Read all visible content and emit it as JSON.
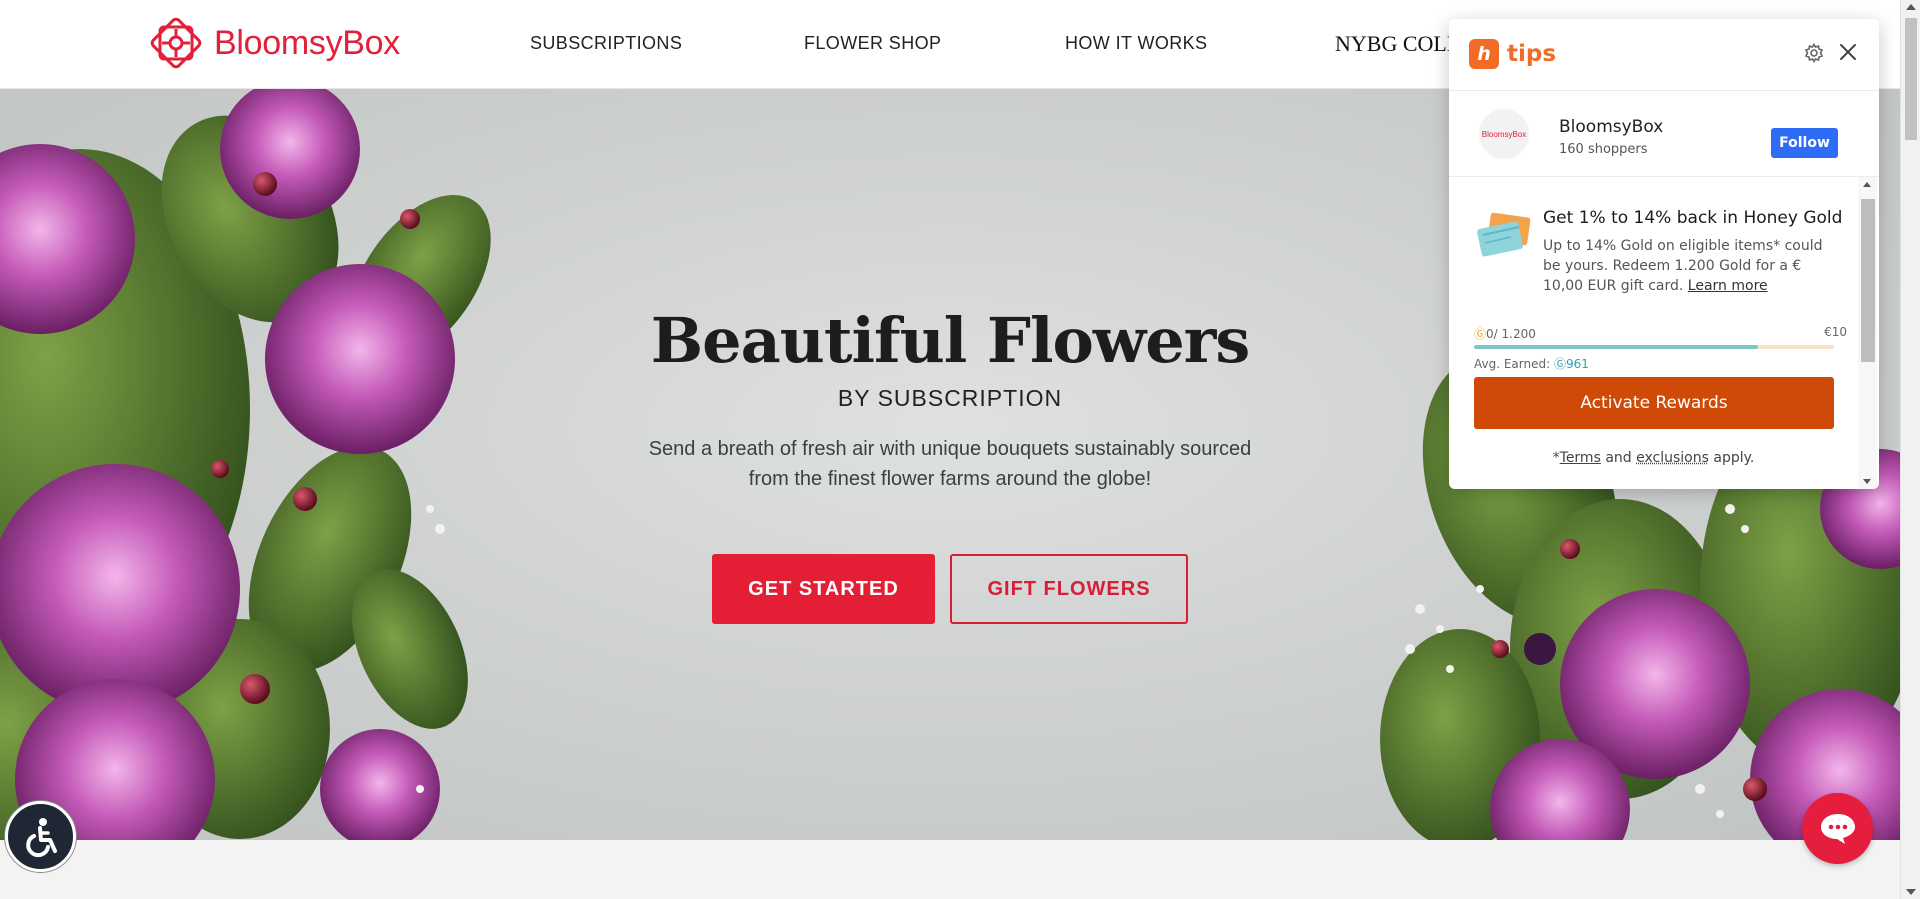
{
  "header": {
    "logo_text": "BloomsyBox",
    "nav": {
      "subscriptions": "SUBSCRIPTIONS",
      "flower_shop": "FLOWER SHOP",
      "how_it_works": "HOW IT WORKS",
      "nybg": "NYBG COLL"
    }
  },
  "hero": {
    "title": "Beautiful Flowers",
    "subtitle": "BY SUBSCRIPTION",
    "description": "Send a breath of fresh air with unique bouquets sustainably sourced from the finest flower farms around the globe!",
    "cta_primary": "GET STARTED",
    "cta_secondary": "GIFT FLOWERS"
  },
  "honey_panel": {
    "brand": "tips",
    "logo_glyph": "h",
    "store": {
      "name": "BloomsyBox",
      "shoppers": "160 shoppers",
      "avatar_text": "BloomsyBox",
      "follow_label": "Follow"
    },
    "offer": {
      "title": "Get 1% to 14% back in Honey Gold",
      "description": "Up to 14% Gold on eligible items* could be yours. Redeem 1.200 Gold for a € 10,00 EUR gift card.",
      "learn_more": "Learn more"
    },
    "progress": {
      "current": "0/ 1.200",
      "goal": "€10",
      "fill_fraction": 0.79,
      "avg_label": "Avg. Earned:",
      "avg_value": "961"
    },
    "activate_label": "Activate Rewards",
    "terms": {
      "prefix": "*",
      "terms_link": "Terms",
      "and": "and",
      "exclusions_link": "exclusions",
      "suffix": "apply."
    }
  },
  "colors": {
    "brand_red": "#e41e34",
    "honey_orange": "#f26c25",
    "activate": "#cf4a06",
    "follow_blue": "#2f6cf5",
    "progress_teal": "#7cc6c9"
  },
  "icons": {
    "accessibility": "accessibility-icon",
    "chat": "chat-icon",
    "settings": "gear-icon",
    "close": "close-icon"
  }
}
